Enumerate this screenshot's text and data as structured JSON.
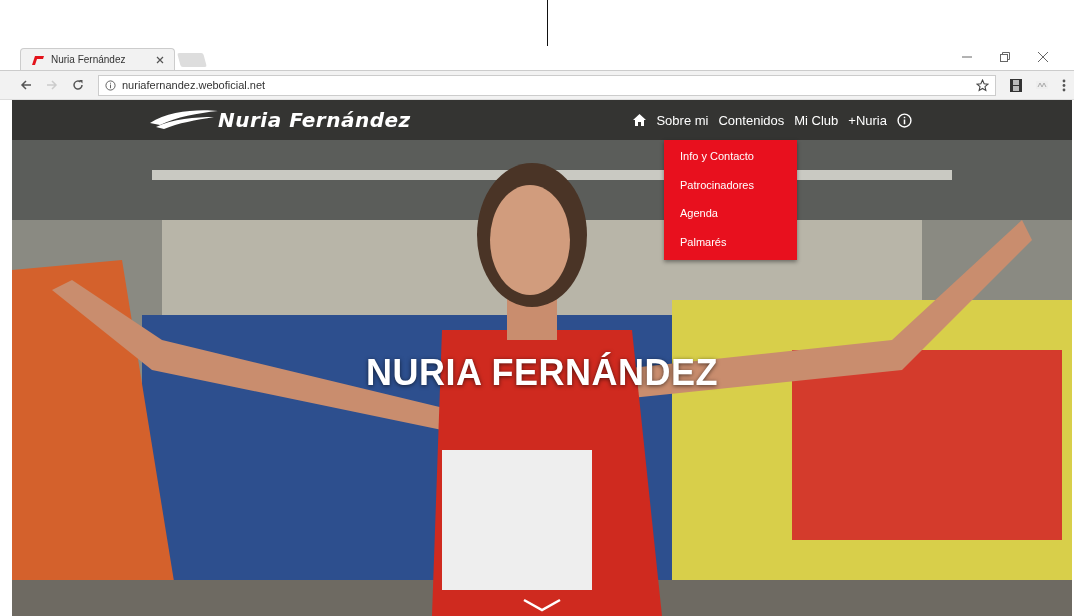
{
  "browser": {
    "tab": {
      "title": "Nuria Fernández"
    },
    "address": "nuriafernandez.weboficial.net"
  },
  "site": {
    "logo": "Nuria Fernández",
    "nav": [
      {
        "kind": "home"
      },
      {
        "kind": "link",
        "label": "Sobre mi"
      },
      {
        "kind": "link",
        "label": "Contenidos"
      },
      {
        "kind": "link",
        "label": "Mi Club"
      },
      {
        "kind": "link",
        "label": "+Nuria"
      },
      {
        "kind": "info"
      }
    ],
    "dropdown": [
      "Info y Contacto",
      "Patrocinadores",
      "Agenda",
      "Palmarés"
    ],
    "hero": {
      "title": "NURIA FERNÁNDEZ"
    }
  }
}
